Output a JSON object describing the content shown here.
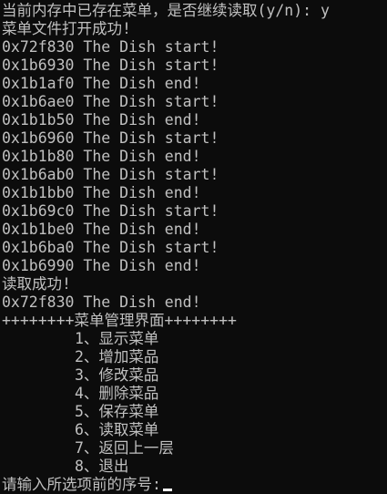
{
  "console": {
    "output_lines": [
      "当前内存中已存在菜单，是否继续读取(y/n): y",
      "菜单文件打开成功!",
      "0x72f830 The Dish start!",
      "0x1b6930 The Dish start!",
      "0x1b1af0 The Dish end!",
      "0x1b6ae0 The Dish start!",
      "0x1b1b50 The Dish end!",
      "0x1b6960 The Dish start!",
      "0x1b1b80 The Dish end!",
      "0x1b6ab0 The Dish start!",
      "0x1b1bb0 The Dish end!",
      "0x1b69c0 The Dish start!",
      "0x1b1be0 The Dish end!",
      "0x1b6ba0 The Dish start!",
      "0x1b6990 The Dish end!",
      "读取成功!",
      "0x72f830 The Dish end!",
      "++++++++菜单管理界面++++++++"
    ],
    "menu_items": [
      "1、显示菜单",
      "2、增加菜品",
      "3、修改菜品",
      "4、删除菜品",
      "5、保存菜单",
      "6、读取菜单",
      "7、返回上一层",
      "8、退出"
    ],
    "prompt": "请输入所选项前的序号:"
  }
}
